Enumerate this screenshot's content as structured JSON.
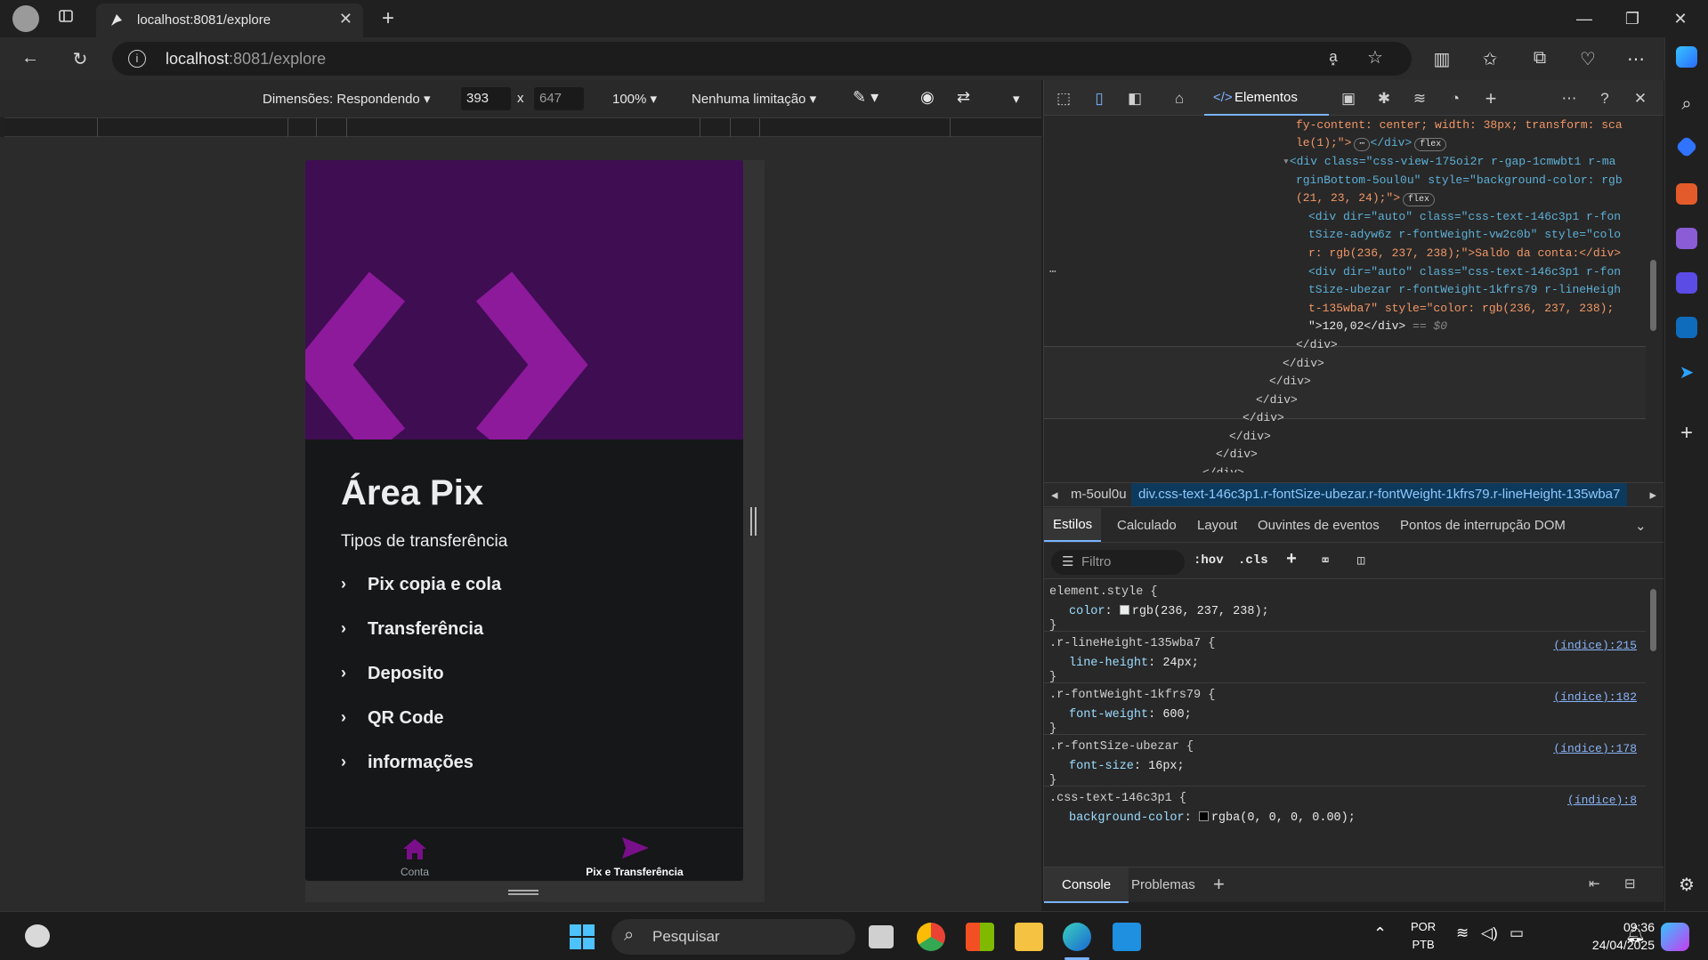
{
  "browser": {
    "tab_title": "localhost:8081/explore",
    "url_host": "localhost",
    "url_rest": ":8081/explore"
  },
  "device_toolbar": {
    "dimensions_label": "Dimensões: Respondendo",
    "width": "393",
    "times": "x",
    "height": "647",
    "zoom": "100%",
    "throttle": "Nenhuma limitação"
  },
  "app": {
    "title": "Área Pix",
    "subtitle": "Tipos de transferência",
    "items": [
      {
        "label": "Pix copia e cola"
      },
      {
        "label": "Transferência"
      },
      {
        "label": "Deposito"
      },
      {
        "label": "QR Code"
      },
      {
        "label": "informações"
      }
    ],
    "nav": [
      {
        "label": "Conta",
        "icon": "home-icon"
      },
      {
        "label": "Pix e Transferência",
        "icon": "send-icon"
      }
    ],
    "colors": {
      "accent": "#7a0f8a",
      "hero_bg": "#3f0d52",
      "hero_shape": "#8c1a9a"
    }
  },
  "devtools": {
    "elements_tab": "Elementos",
    "dom_lines": [
      {
        "t": "fy-content: center; width: 38px; transform: sca"
      },
      {
        "t": "le(1);\">"
      },
      {
        "t": "<div class=\"css-view-175oi2r r-gap-1cmwbt1 r-ma"
      },
      {
        "t": "rginBottom-5oul0u\" style=\"background-color: rgb"
      },
      {
        "t": "(21, 23, 24);\">"
      },
      {
        "t": "<div dir=\"auto\" class=\"css-text-146c3p1 r-fon"
      },
      {
        "t": "tSize-adyw6z r-fontWeight-vw2c0b\" style=\"colo"
      },
      {
        "t": "r: rgb(236, 237, 238);\">Saldo da conta:</div>"
      },
      {
        "t": "<div dir=\"auto\" class=\"css-text-146c3p1 r-fon"
      },
      {
        "t": "tSize-ubezar r-fontWeight-1kfrs79 r-lineHeigh"
      },
      {
        "t": "t-135wba7\" style=\"color: rgb(236, 237, 238);"
      },
      {
        "t": "\">120,02</div>"
      },
      {
        "t": "</div>"
      },
      {
        "t": "</div>"
      },
      {
        "t": "</div>"
      },
      {
        "t": "</div>"
      },
      {
        "t": "</div>"
      },
      {
        "t": "</div>"
      },
      {
        "t": "</div>"
      },
      {
        "t": "</div>"
      }
    ],
    "dom_dollar": "== $0",
    "flex_badge": "flex",
    "breadcrumb_prev": "m-5oul0u",
    "breadcrumb_current": "div.css-text-146c3p1.r-fontSize-ubezar.r-fontWeight-1kfrs79.r-lineHeight-135wba7",
    "style_tabs": [
      "Estilos",
      "Calculado",
      "Layout",
      "Ouvintes de eventos",
      "Pontos de interrupção DOM"
    ],
    "filter_placeholder": "Filtro",
    "hov": ":hov",
    "cls": ".cls",
    "rules": [
      {
        "selector": "element.style {",
        "prop": "color",
        "value": "rgb(236, 237, 238);",
        "swatch": "#ecedee",
        "src": ""
      },
      {
        "selector": ".r-lineHeight-135wba7 {",
        "prop": "line-height",
        "value": "24px;",
        "swatch": "",
        "src": "(índice):215"
      },
      {
        "selector": ".r-fontWeight-1kfrs79 {",
        "prop": "font-weight",
        "value": "600;",
        "swatch": "",
        "src": "(índice):182"
      },
      {
        "selector": ".r-fontSize-ubezar {",
        "prop": "font-size",
        "value": "16px;",
        "swatch": "",
        "src": "(índice):178"
      },
      {
        "selector": ".css-text-146c3p1 {",
        "prop": "background-color",
        "value": "rgba(0, 0, 0, 0.00);",
        "swatch": "#000000",
        "src": "(índice):8"
      }
    ],
    "close_brace": "}",
    "console_tabs": [
      "Console",
      "Problemas"
    ]
  },
  "taskbar": {
    "search_placeholder": "Pesquisar",
    "lang1": "POR",
    "lang2": "PTB",
    "time": "09:36",
    "date": "24/04/2025"
  }
}
